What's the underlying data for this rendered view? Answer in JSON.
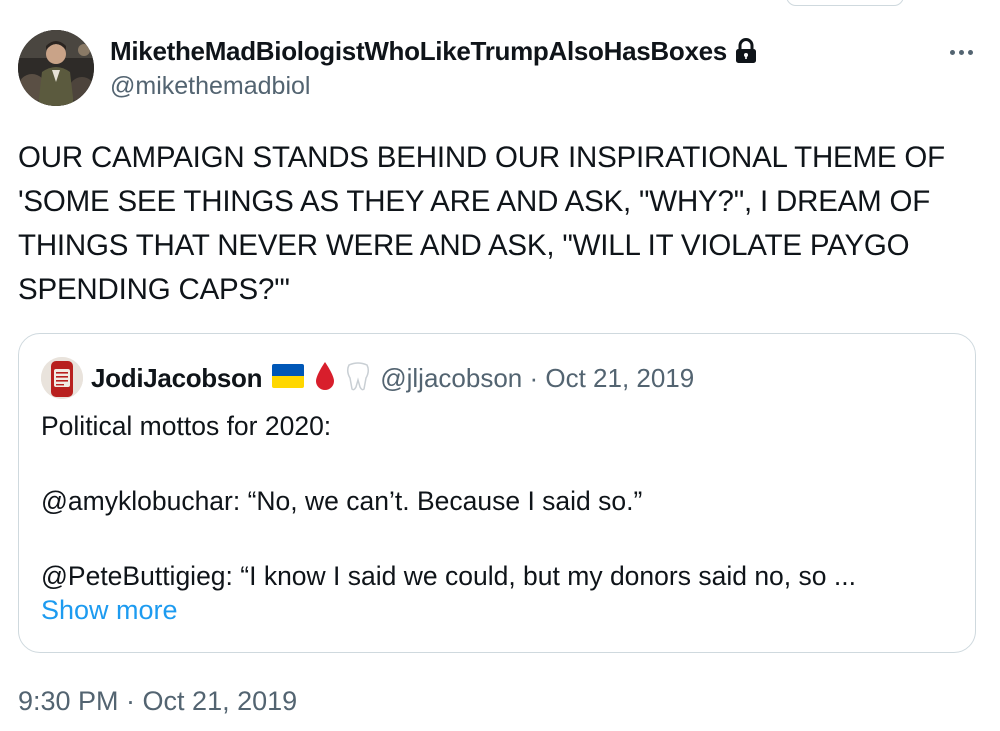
{
  "author": {
    "display_name": "MiketheMadBiologistWhoLikeTrumpAlsoHasBoxes",
    "handle": "@mikethemadbiol",
    "protected_icon": "lock-icon"
  },
  "tweet": {
    "text": "OUR CAMPAIGN STANDS BEHIND OUR INSPIRATIONAL THEME OF 'SOME SEE THINGS AS THEY ARE AND ASK, \"WHY?\", I DREAM OF THINGS THAT NEVER WERE AND ASK, \"WILL IT VIOLATE PAYGO SPENDING CAPS?\"'",
    "timestamp": "9:30 PM · Oct 21, 2019"
  },
  "quoted": {
    "display_name": "JodiJacobson",
    "emoji": [
      "ukraine-flag-icon",
      "blood-drop-icon",
      "tooth-icon"
    ],
    "handle_date": "@jljacobson · Oct 21, 2019",
    "line1": "Political mottos for 2020:",
    "line2": "@amyklobuchar: “No, we can’t. Because I said so.”",
    "line3": "@PeteButtigieg: “I know I said we could, but my donors said no, so ...",
    "show_more": "Show more"
  },
  "colors": {
    "text": "#0f1419",
    "secondary": "#536471",
    "link": "#1d9bf0",
    "border": "#cfd9de"
  }
}
